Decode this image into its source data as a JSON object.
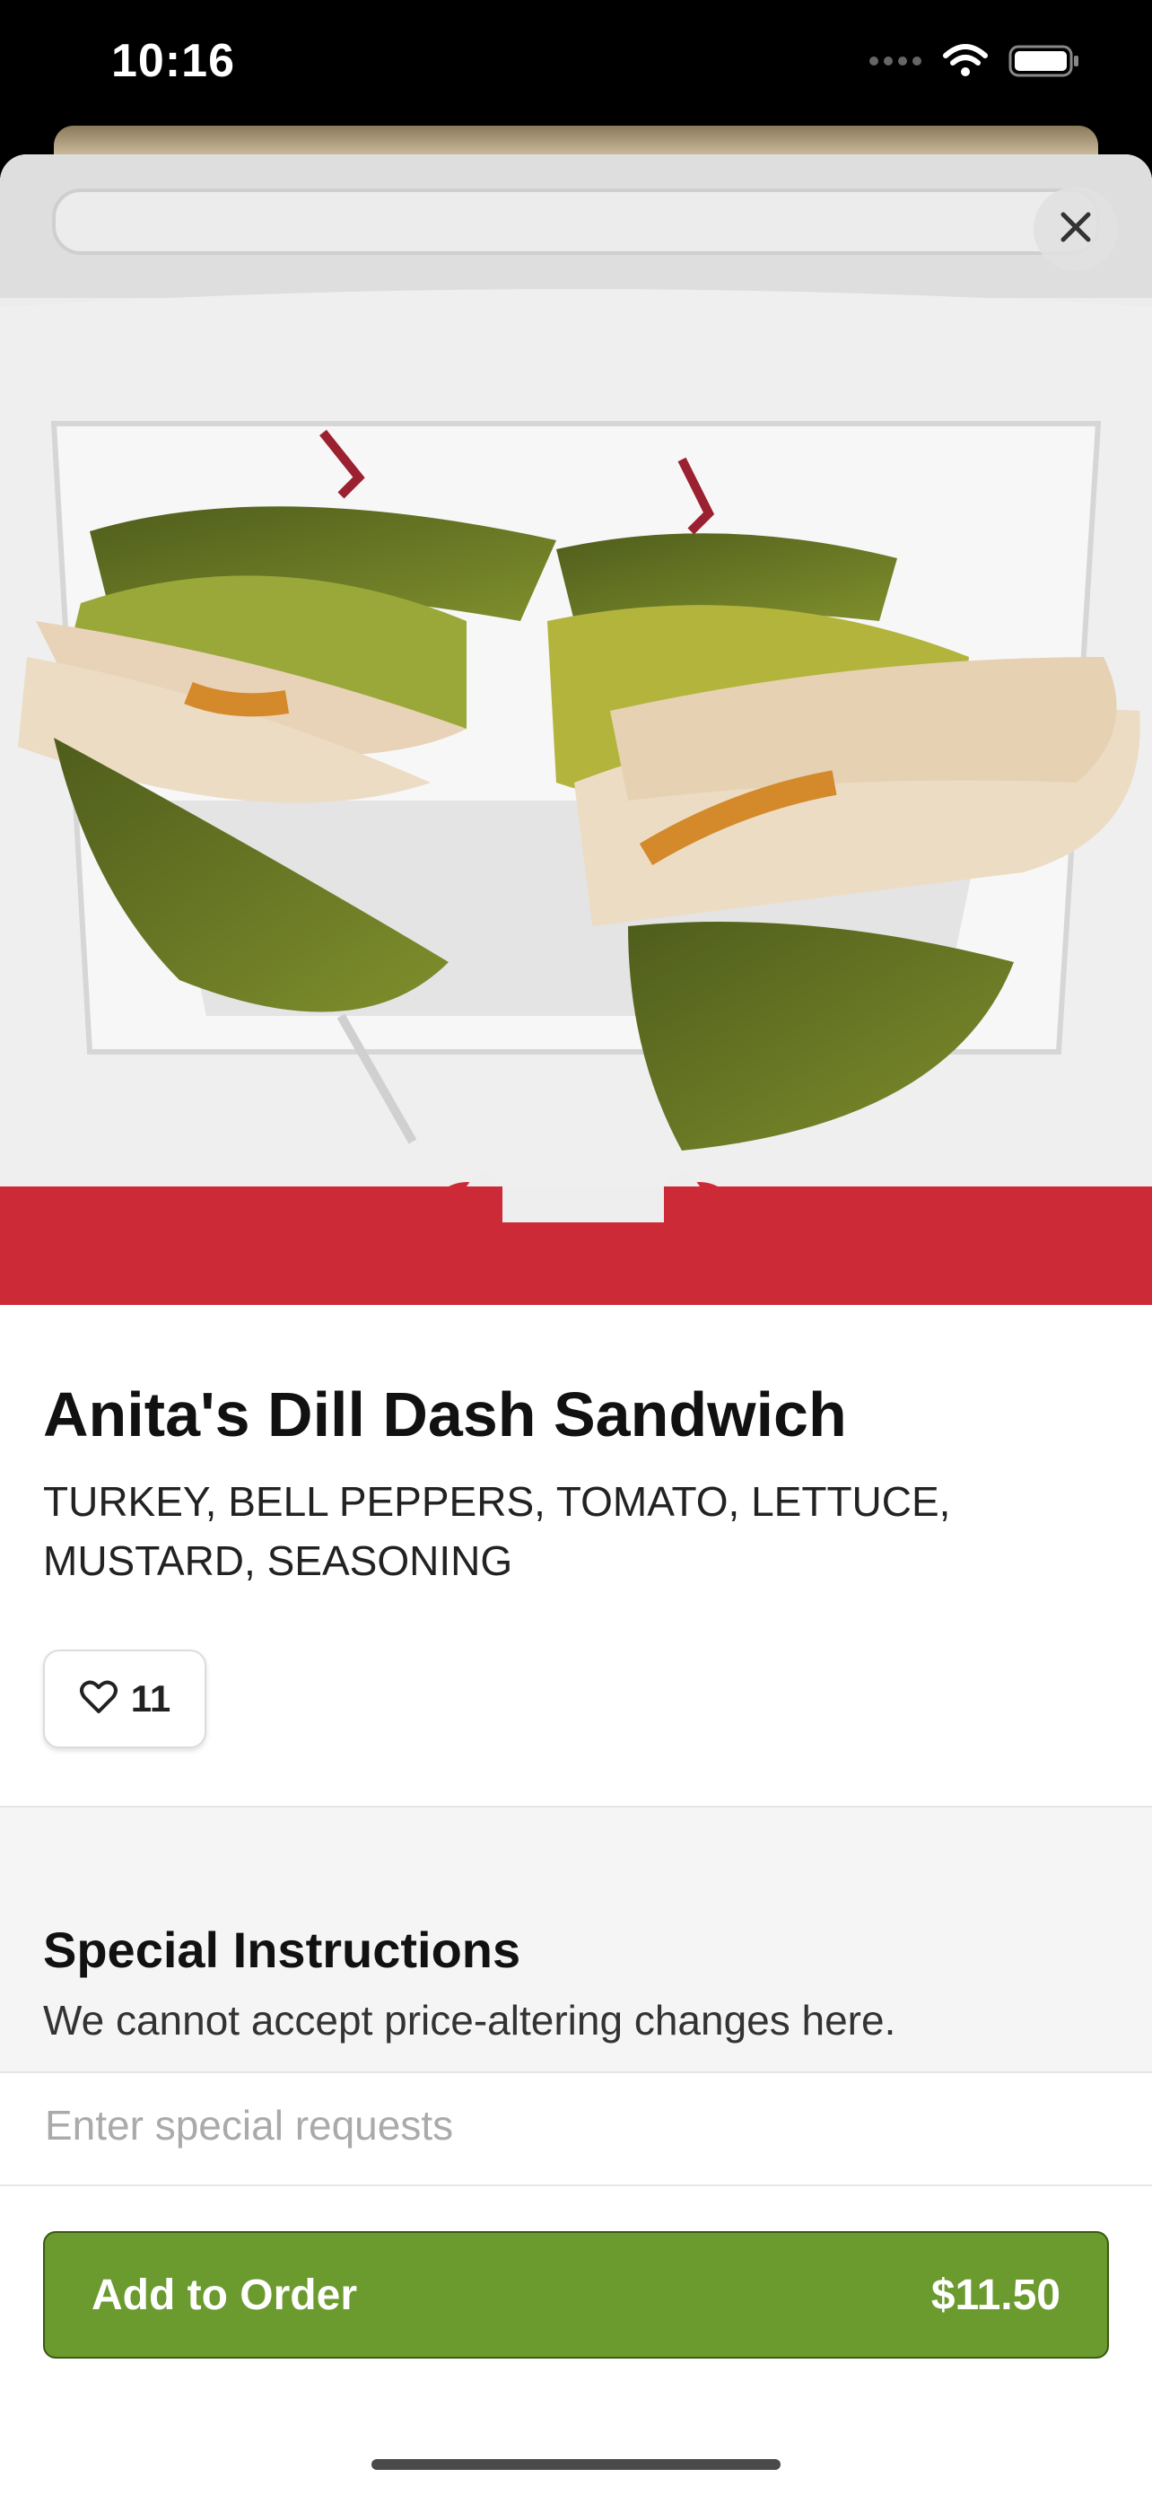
{
  "status_bar": {
    "time": "10:16"
  },
  "item": {
    "name": "Anita's Dill Dash Sandwich",
    "description": "TURKEY, BELL PEPPERS, TOMATO, LETTUCE, MUSTARD, SEASONING",
    "like_count": "11"
  },
  "special_instructions": {
    "title": "Special Instructions",
    "subtitle": "We cannot accept price-altering changes here.",
    "placeholder": "Enter special requests"
  },
  "footer": {
    "add_label": "Add to Order",
    "price": "$11.50"
  },
  "colors": {
    "accent": "#6b9a2e",
    "hero_bottom_band": "#cc2a36"
  }
}
